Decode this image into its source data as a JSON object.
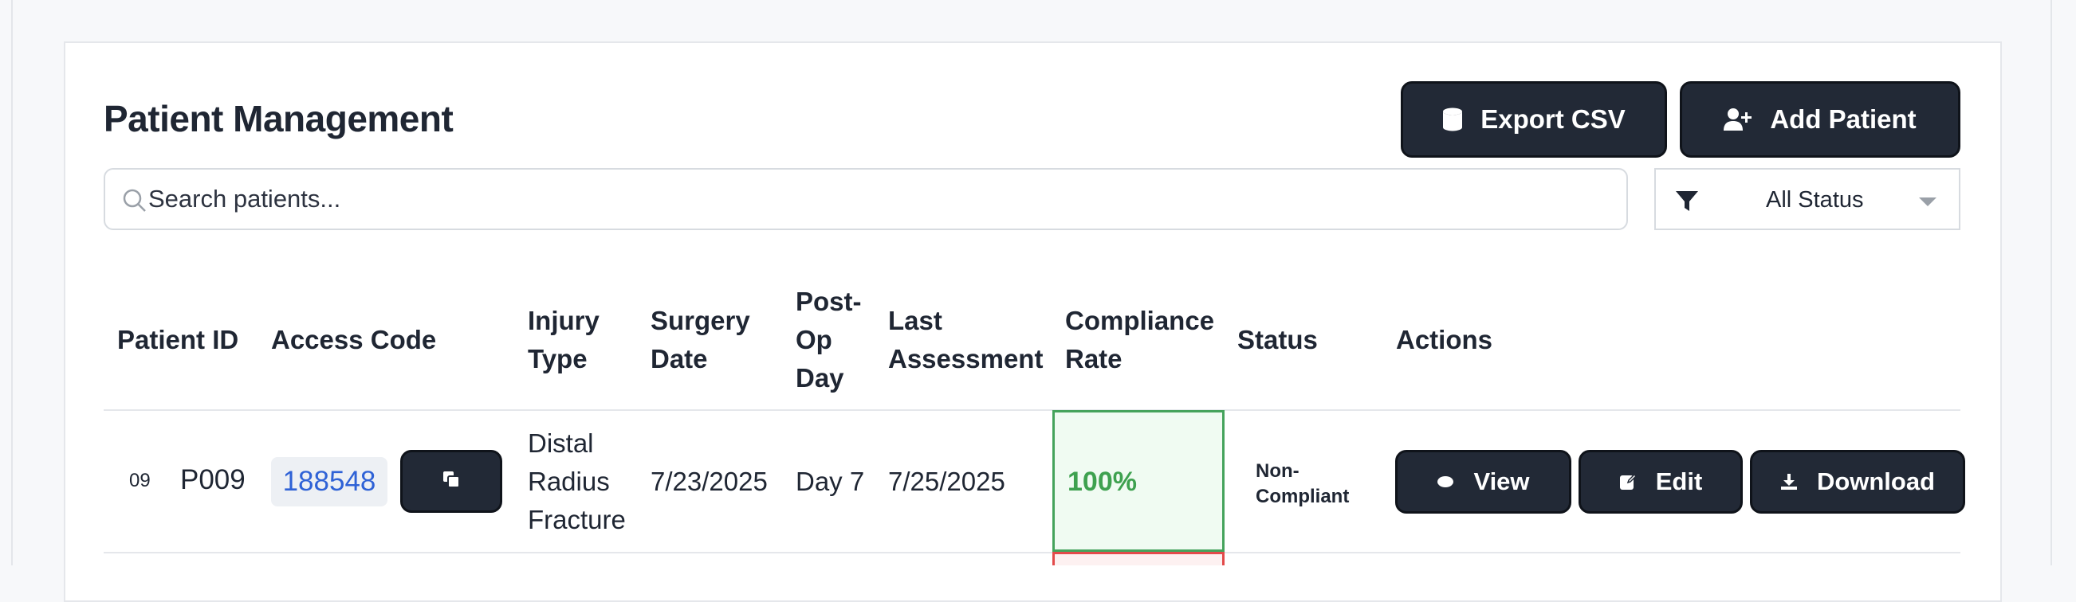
{
  "header": {
    "title": "Patient Management",
    "export_label": "Export CSV",
    "add_label": "Add Patient"
  },
  "search": {
    "placeholder": "Search patients..."
  },
  "filter": {
    "selected": "All Status"
  },
  "table": {
    "headers": {
      "patient_id": "Patient ID",
      "access_code": "Access Code",
      "injury_type": [
        "Injury",
        "Type"
      ],
      "surgery_date": [
        "Surgery",
        "Date"
      ],
      "post_op_day": [
        "Post-",
        "Op",
        "Day"
      ],
      "last_assessment": [
        "Last",
        "Assessment"
      ],
      "compliance_rate": [
        "Compliance",
        "Rate"
      ],
      "status": "Status",
      "actions": "Actions"
    },
    "rows": [
      {
        "row_number": "09",
        "patient_id": "P009",
        "access_code": "188548",
        "injury_type": [
          "Distal",
          "Radius",
          "Fracture"
        ],
        "surgery_date": "7/23/2025",
        "post_op_day": "Day 7",
        "last_assessment": "7/25/2025",
        "compliance_rate": "100%",
        "status": [
          "Non-",
          "Compliant"
        ],
        "actions": {
          "view": "View",
          "edit": "Edit",
          "download": "Download"
        }
      }
    ]
  },
  "colors": {
    "dark_button": "#222936",
    "compliance_good": "#3ea14f",
    "compliance_bad": "#e24a4a",
    "link_blue": "#2f62d6"
  }
}
